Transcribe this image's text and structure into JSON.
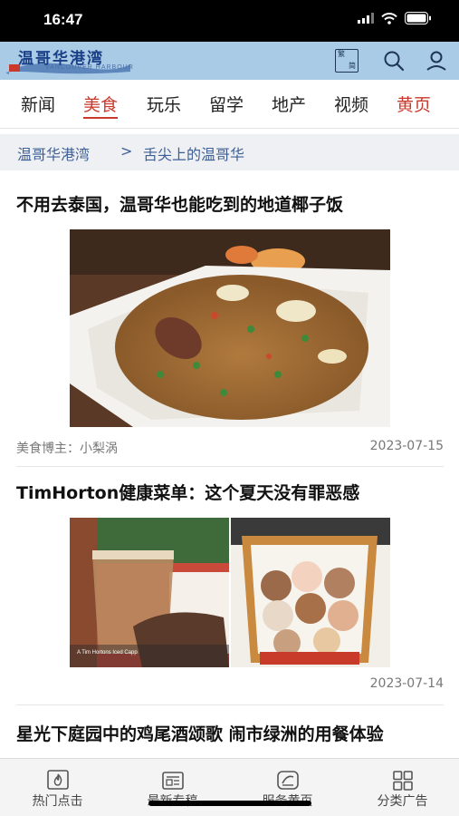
{
  "status_bar": {
    "time": "16:47"
  },
  "header": {
    "logo_title": "温哥华港湾",
    "logo_subtitle": "VANCOUVER HARBOUR",
    "icons": [
      "traditional-simplified-toggle-icon",
      "search-icon",
      "user-icon"
    ],
    "lang_toggle_top": "繁",
    "lang_toggle_bottom": "简"
  },
  "nav": {
    "items": [
      {
        "label": "新闻"
      },
      {
        "label": "美食"
      },
      {
        "label": "玩乐"
      },
      {
        "label": "留学"
      },
      {
        "label": "地产"
      },
      {
        "label": "视频"
      },
      {
        "label": "黄页"
      }
    ],
    "active_index": 1,
    "accent_color": "#c8392b"
  },
  "breadcrumb": {
    "home": "温哥华港湾",
    "separator": ">",
    "current": "舌尖上的温哥华"
  },
  "articles": [
    {
      "title": "不用去泰国，温哥华也能吃到的地道椰子饭",
      "author": "美食博主：小梨涡",
      "date": "2023-07-15"
    },
    {
      "title": "TimHorton健康菜单：这个夏天没有罪恶感",
      "image_caption": "A Tim Hortons Iced Capp",
      "date": "2023-07-14"
    },
    {
      "title": "星光下庭园中的鸡尾酒颂歌 闹市绿洲的用餐体验"
    }
  ],
  "bottom_tabs": [
    {
      "label": "热门点击",
      "icon": "fire-icon"
    },
    {
      "label": "最新专稿",
      "icon": "newspaper-icon"
    },
    {
      "label": "服务黄页",
      "icon": "service-icon"
    },
    {
      "label": "分类广告",
      "icon": "grid-icon"
    }
  ]
}
